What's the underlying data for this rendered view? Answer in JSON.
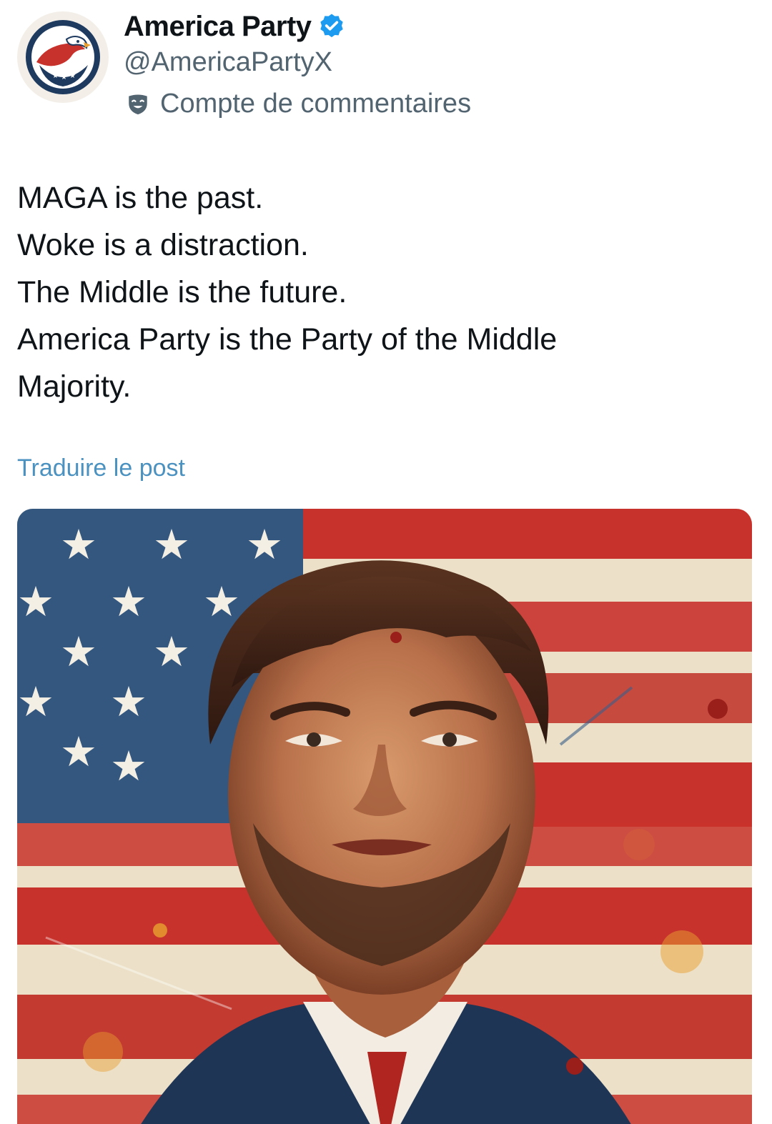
{
  "account": {
    "display_name": "America Party",
    "handle": "@AmericaPartyX",
    "account_type": "Compte de commentaires",
    "verified": true,
    "avatar_icon": "eagle-logo-icon",
    "verified_icon": "verified-badge-icon",
    "account_type_icon": "parody-mask-icon"
  },
  "post": {
    "lines": [
      "MAGA is the past.",
      "Woke is a distraction.",
      "The Middle is the future.",
      "America Party is the Party of the Middle",
      "Majority."
    ],
    "translate_label": "Traduire le post"
  },
  "media": {
    "type": "illustration",
    "subject": "portrait of a man in front of an American flag"
  },
  "colors": {
    "text_primary": "#0f1419",
    "text_secondary": "#536471",
    "link": "#1d9bf0",
    "verified": "#1d9bf0",
    "flag_red": "#c8322c",
    "flag_blue": "#3a5f8a"
  }
}
